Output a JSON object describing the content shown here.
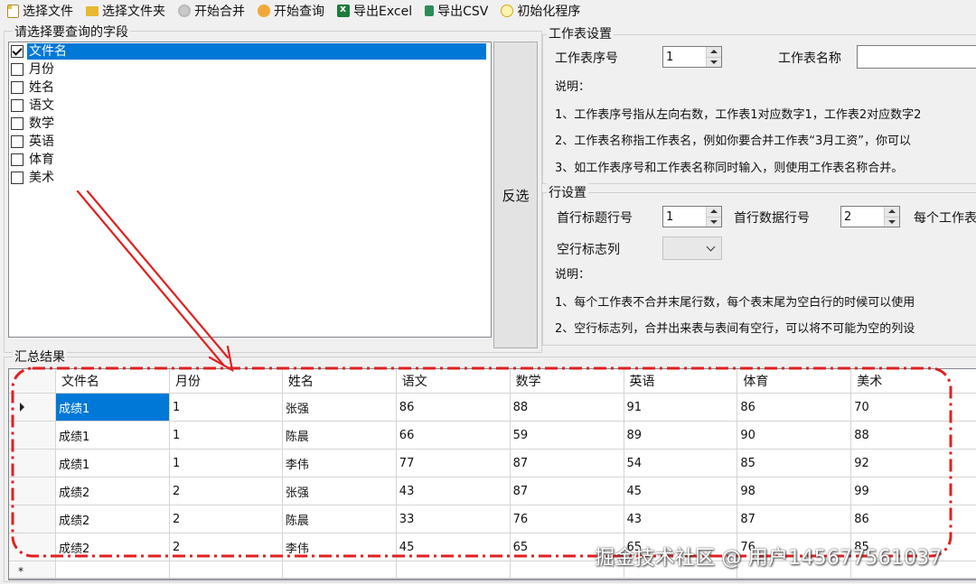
{
  "toolbar": {
    "buttons": [
      {
        "label": "选择文件",
        "icon": "file-icon"
      },
      {
        "label": "选择文件夹",
        "icon": "folder-icon"
      },
      {
        "label": "开始合并",
        "icon": "merge-icon"
      },
      {
        "label": "开始查询",
        "icon": "query-icon"
      },
      {
        "label": "导出Excel",
        "icon": "excel-icon"
      },
      {
        "label": "导出CSV",
        "icon": "csv-icon"
      },
      {
        "label": "初始化程序",
        "icon": "init-icon"
      }
    ]
  },
  "fields": {
    "title": "请选择要查询的字段",
    "items": [
      {
        "label": "文件名",
        "checked": true,
        "selected": true
      },
      {
        "label": "月份",
        "checked": false
      },
      {
        "label": "姓名",
        "checked": false
      },
      {
        "label": "语文",
        "checked": false
      },
      {
        "label": "数学",
        "checked": false
      },
      {
        "label": "英语",
        "checked": false
      },
      {
        "label": "体育",
        "checked": false
      },
      {
        "label": "美术",
        "checked": false
      }
    ],
    "invert_label": "反选"
  },
  "sheet_settings": {
    "title": "工作表设置",
    "index_label": "工作表序号",
    "index_value": "1",
    "name_label": "工作表名称",
    "name_value": "",
    "notes_title": "说明：",
    "notes": [
      "1、工作表序号指从左向右数，工作表1对应数字1，工作表2对应数字2",
      "2、工作表名称指工作表名，例如你要合并工作表“3月工资”，你可以",
      "3、如工作表序号和工作表名称同时输入，则使用工作表名称合并。"
    ]
  },
  "row_settings": {
    "title": "行设置",
    "header_row_label": "首行标题行号",
    "header_row_value": "1",
    "data_row_label": "首行数据行号",
    "data_row_value": "2",
    "each_sheet_label": "每个工作表",
    "blank_col_label": "空行标志列",
    "blank_col_value": "",
    "notes_title": "说明：",
    "notes": [
      "1、每个工作表不合并末尾行数，每个表末尾为空白行的时候可以使用",
      "2、空行标志列，合并出来表与表间有空行，可以将不可能为空的列设"
    ]
  },
  "results": {
    "title": "汇总结果",
    "columns": [
      "文件名",
      "月份",
      "姓名",
      "语文",
      "数学",
      "英语",
      "体育",
      "美术"
    ],
    "rows": [
      [
        "成绩1",
        "1",
        "张强",
        "86",
        "88",
        "91",
        "86",
        "70"
      ],
      [
        "成绩1",
        "1",
        "陈晨",
        "66",
        "59",
        "89",
        "90",
        "88"
      ],
      [
        "成绩1",
        "1",
        "李伟",
        "77",
        "87",
        "54",
        "85",
        "92"
      ],
      [
        "成绩2",
        "2",
        "张强",
        "43",
        "87",
        "45",
        "98",
        "99"
      ],
      [
        "成绩2",
        "2",
        "陈晨",
        "33",
        "76",
        "43",
        "87",
        "86"
      ],
      [
        "成绩2",
        "2",
        "李伟",
        "45",
        "65",
        "65",
        "76",
        "85"
      ]
    ],
    "new_row_marker": "*"
  },
  "watermark": "掘金技术社区 @ 用户1456775610​37",
  "colors": {
    "selection": "#0078d7",
    "annotation_red": "#e02020"
  }
}
